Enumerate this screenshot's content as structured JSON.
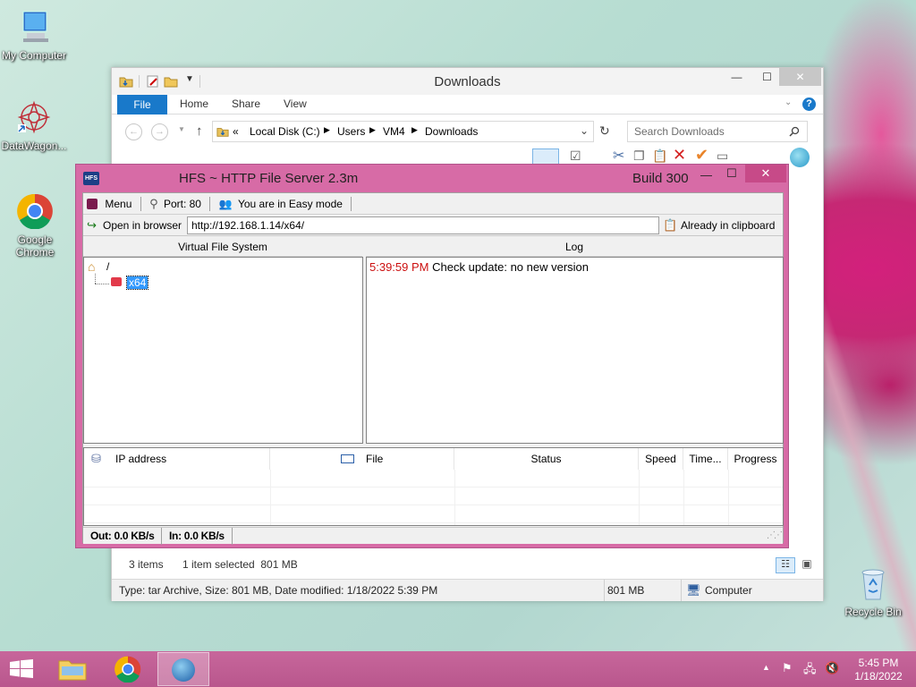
{
  "desktop": {
    "icons": [
      "My Computer",
      "DataWagon...",
      "Google Chrome",
      "Recycle Bin"
    ]
  },
  "explorer": {
    "title": "Downloads",
    "tabs": [
      "File",
      "Home",
      "Share",
      "View"
    ],
    "address": {
      "prefix": "«",
      "parts": [
        "Local Disk (C:)",
        "Users",
        "VM4",
        "Downloads"
      ]
    },
    "search_placeholder": "Search Downloads",
    "status": {
      "items": "3 items",
      "selected": "1 item selected  801 MB"
    },
    "details": {
      "info": "Type: tar Archive, Size: 801 MB, Date modified: 1/18/2022 5:39 PM",
      "size": "801 MB",
      "location": "Computer"
    }
  },
  "hfs": {
    "title": "HFS ~ HTTP File Server 2.3m",
    "build": "Build 300",
    "logo": "HFS",
    "toolbar": {
      "menu": "Menu",
      "port": "Port: 80",
      "mode": "You are in Easy mode"
    },
    "urlbar": {
      "open": "Open in browser",
      "url": "http://192.168.1.14/x64/",
      "clipboard": "Already in clipboard"
    },
    "vfs": {
      "header": "Virtual File System",
      "root": "/",
      "folder": "x64"
    },
    "log": {
      "header": "Log",
      "entries": [
        {
          "time": "5:39:59 PM",
          "text": "Check update: no new version"
        }
      ]
    },
    "connections": {
      "columns": [
        "IP address",
        "File",
        "Status",
        "Speed",
        "Time...",
        "Progress"
      ]
    },
    "status": {
      "out": "Out: 0.0 KB/s",
      "in": "In: 0.0 KB/s"
    }
  },
  "taskbar": {
    "time": "5:45 PM",
    "date": "1/18/2022"
  },
  "colors": {
    "hfs_frame": "#d76ba6",
    "ribbon_file": "#1979ca",
    "log_time": "#cc1111",
    "selection": "#3399ff"
  }
}
